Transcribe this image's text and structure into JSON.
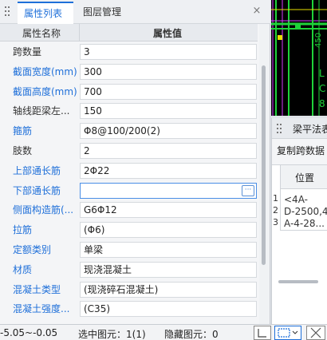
{
  "tabs": [
    {
      "label": "属性列表"
    },
    {
      "label": "图层管理"
    }
  ],
  "close_glyph": "×",
  "table_header": {
    "name_col": "属性名称",
    "value_col": "属性值"
  },
  "rows": [
    {
      "name": "跨数量",
      "value": "3",
      "color": "dark"
    },
    {
      "name": "截面宽度(mm)",
      "value": "300",
      "color": "blue"
    },
    {
      "name": "截面高度(mm)",
      "value": "700",
      "color": "blue"
    },
    {
      "name": "轴线距梁左...",
      "value": "150",
      "color": "dark"
    },
    {
      "name": "箍筋",
      "value": "Φ8@100/200(2)",
      "color": "blue"
    },
    {
      "name": "肢数",
      "value": "2",
      "color": "dark"
    },
    {
      "name": "上部通长筋",
      "value": "2Φ22",
      "color": "blue"
    },
    {
      "name": "下部通长筋",
      "value": "",
      "color": "blue"
    },
    {
      "name": "侧面构造筋(...",
      "value": "G6Φ12",
      "color": "blue"
    },
    {
      "name": "拉筋",
      "value": "(Φ6)",
      "color": "blue"
    },
    {
      "name": "定额类别",
      "value": "单梁",
      "color": "blue"
    },
    {
      "name": "材质",
      "value": "现浇混凝土",
      "color": "blue"
    },
    {
      "name": "混凝土类型",
      "value": "(现浇碎石混凝土)",
      "color": "blue"
    },
    {
      "name": "混凝土强度...",
      "value": "(C35)",
      "color": "blue"
    }
  ],
  "ellipsis_label": "···",
  "status": {
    "coord": "-5.05~-0.05",
    "selected": "选中图元：1(1)",
    "hidden": "隐藏图元：0"
  },
  "beam_panel": {
    "title": "梁平法表",
    "copy_label": "复制跨数据",
    "position_header": "位置",
    "row_numbers": [
      "1",
      "2",
      "3"
    ],
    "cell_lines": [
      "<4A-",
      "D-2500,4",
      "A-4-28..."
    ]
  },
  "cad_labels": {
    "num": "450",
    "l1": "L",
    "l2": "C",
    "l3": "8"
  },
  "colors": {
    "accent": "#1e6fd9",
    "cad_bg": "#000000",
    "cad_green": "#1fd23a",
    "cad_yellow": "#e8e000",
    "cad_magenta": "#d63aff"
  }
}
